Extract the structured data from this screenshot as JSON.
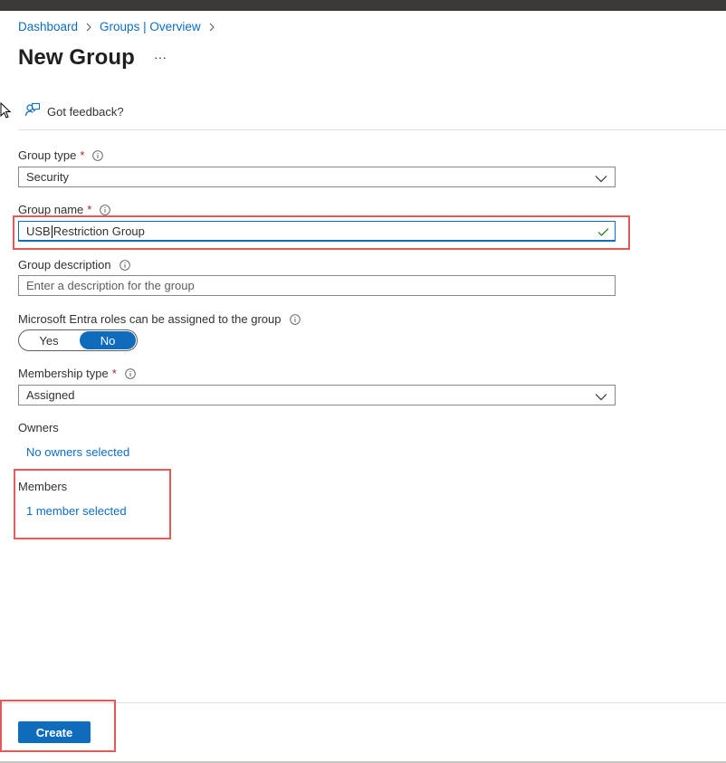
{
  "breadcrumb": {
    "items": [
      {
        "label": "Dashboard"
      },
      {
        "label": "Groups | Overview"
      }
    ]
  },
  "page": {
    "title": "New Group",
    "more_label": "···"
  },
  "feedback": {
    "label": "Got feedback?",
    "icon": "feedback-icon"
  },
  "form": {
    "group_type": {
      "label": "Group type",
      "required_mark": "*",
      "value": "Security"
    },
    "group_name": {
      "label": "Group name",
      "required_mark": "*",
      "value_before_caret": "USB",
      "value_after_caret": "Restriction Group",
      "valid": true
    },
    "group_description": {
      "label": "Group description",
      "placeholder": "Enter a description for the group",
      "value": ""
    },
    "entra_roles": {
      "label": "Microsoft Entra roles can be assigned to the group",
      "yes_label": "Yes",
      "no_label": "No",
      "selected": "No"
    },
    "membership_type": {
      "label": "Membership type",
      "required_mark": "*",
      "value": "Assigned"
    },
    "owners": {
      "label": "Owners",
      "link": "No owners selected"
    },
    "members": {
      "label": "Members",
      "link": "1 member selected"
    }
  },
  "footer": {
    "create_label": "Create"
  },
  "colors": {
    "accent": "#0f6cbd",
    "required": "#a4262c",
    "highlight": "#e05a5a",
    "valid_check": "#107c10"
  }
}
